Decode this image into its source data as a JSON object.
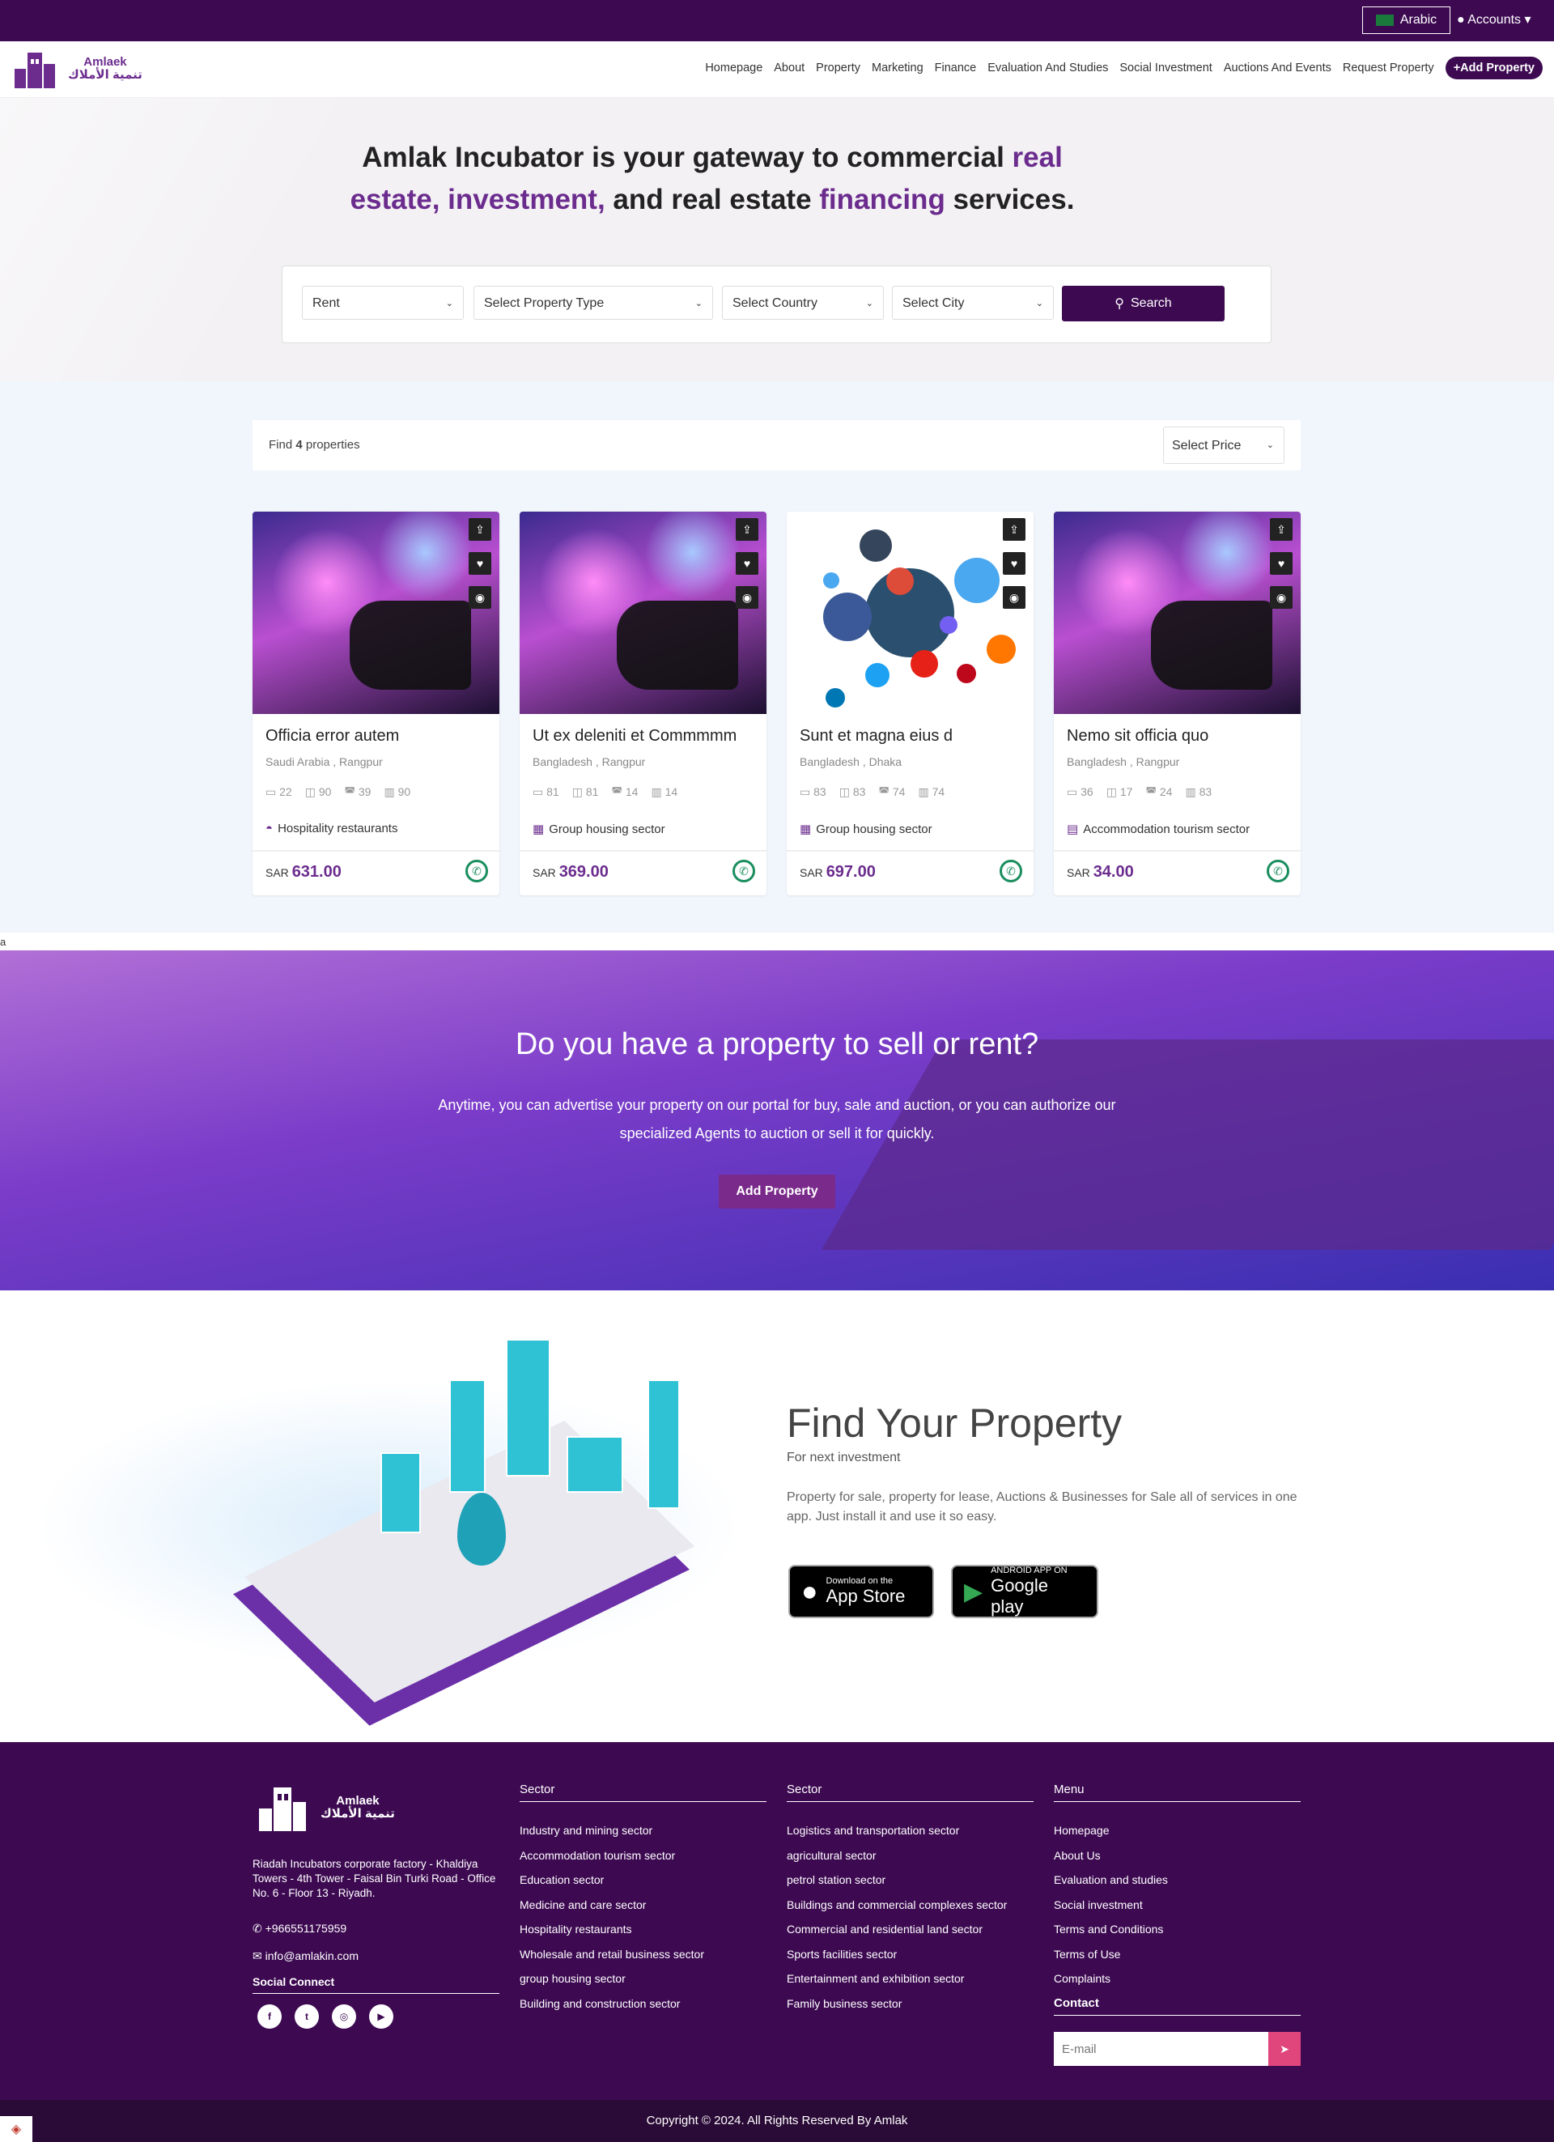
{
  "topbar": {
    "language": "Arabic",
    "accounts": "Accounts"
  },
  "brand": {
    "name_en": "Amlaek",
    "name_ar": "تنمية الأملاك"
  },
  "nav": {
    "items": [
      "Homepage",
      "About",
      "Property",
      "Marketing",
      "Finance",
      "Evaluation And Studies",
      "Social Investment",
      "Auctions And Events",
      "Request Property"
    ],
    "add": "+Add Property"
  },
  "hero": {
    "title_1": "Amlak Incubator is your gateway to commercial ",
    "title_hl_1": "real estate, investment,",
    "title_2": " and real estate ",
    "title_hl_2": "financing",
    "title_3": " services."
  },
  "search": {
    "rent": "Rent",
    "type": "Select Property Type",
    "country": "Select Country",
    "city": "Select City",
    "button": "Search"
  },
  "listing": {
    "find_prefix": "Find",
    "count": "4",
    "find_suffix": "properties",
    "price_select": "Select Price",
    "currency": "SAR"
  },
  "properties": [
    {
      "title": "Officia error autem",
      "location": "Saudi Arabia , Rangpur",
      "stats": [
        "22",
        "90",
        "39",
        "90"
      ],
      "category": "Hospitality restaurants",
      "price": "631.00"
    },
    {
      "title": "Ut ex deleniti et Commmmm",
      "location": "Bangladesh , Rangpur",
      "stats": [
        "81",
        "81",
        "14",
        "14"
      ],
      "category": "Group housing sector",
      "price": "369.00"
    },
    {
      "title": "Sunt et magna eius d",
      "location": "Bangladesh , Dhaka",
      "stats": [
        "83",
        "83",
        "74",
        "74"
      ],
      "category": "Group housing sector",
      "price": "697.00"
    },
    {
      "title": "Nemo sit officia quo",
      "location": "Bangladesh , Rangpur",
      "stats": [
        "36",
        "17",
        "24",
        "83"
      ],
      "category": "Accommodation tourism sector",
      "price": "34.00"
    }
  ],
  "stray": "a",
  "promo": {
    "title": "Do you have a property to sell or rent?",
    "text": "Anytime, you can advertise your property on our portal for buy, sale and auction, or you can authorize our specialized Agents to auction or sell it for quickly.",
    "button": "Add Property"
  },
  "app": {
    "title": "Find Your Property",
    "subtitle": "For next investment",
    "text": "Property for sale, property for lease, Auctions & Businesses for Sale all of services in one app. Just install it and use it so easy.",
    "appstore_small": "Download on the",
    "appstore_big": "App Store",
    "play_small": "ANDROID APP ON",
    "play_big": "Google play"
  },
  "footer": {
    "address": "Riadah Incubators corporate factory - Khaldiya Towers - 4th Tower - Faisal Bin Turki Road - Office No. 6 - Floor 13 - Riyadh.",
    "phone": "+966551175959",
    "email": "info@amlakin.com",
    "social_title": "Social Connect",
    "col1": {
      "title": "Sector",
      "items": [
        "Industry and mining sector",
        "Accommodation tourism sector",
        "Education sector",
        "Medicine and care sector",
        "Hospitality restaurants",
        "Wholesale and retail business sector",
        "group housing sector",
        "Building and construction sector"
      ]
    },
    "col2": {
      "title": "Sector",
      "items": [
        "Logistics and transportation sector",
        "agricultural sector",
        "petrol station sector",
        "Buildings and commercial complexes sector",
        "Commercial and residential land sector",
        "Sports facilities sector",
        "Entertainment and exhibition sector",
        "Family business sector"
      ]
    },
    "col3": {
      "title": "Menu",
      "items": [
        "Homepage",
        "About Us",
        "Evaluation and studies",
        "Social investment",
        "Terms and Conditions",
        "Terms of Use",
        "Complaints"
      ]
    },
    "contact_title": "Contact",
    "email_placeholder": "E-mail",
    "copyright": "Copyright © 2024. All Rights Reserved By Amlak"
  },
  "colors": {
    "brand": "#3d0a52",
    "accent": "#6b2c8e",
    "whatsapp": "#1a8e5e",
    "send": "#e0457b"
  }
}
